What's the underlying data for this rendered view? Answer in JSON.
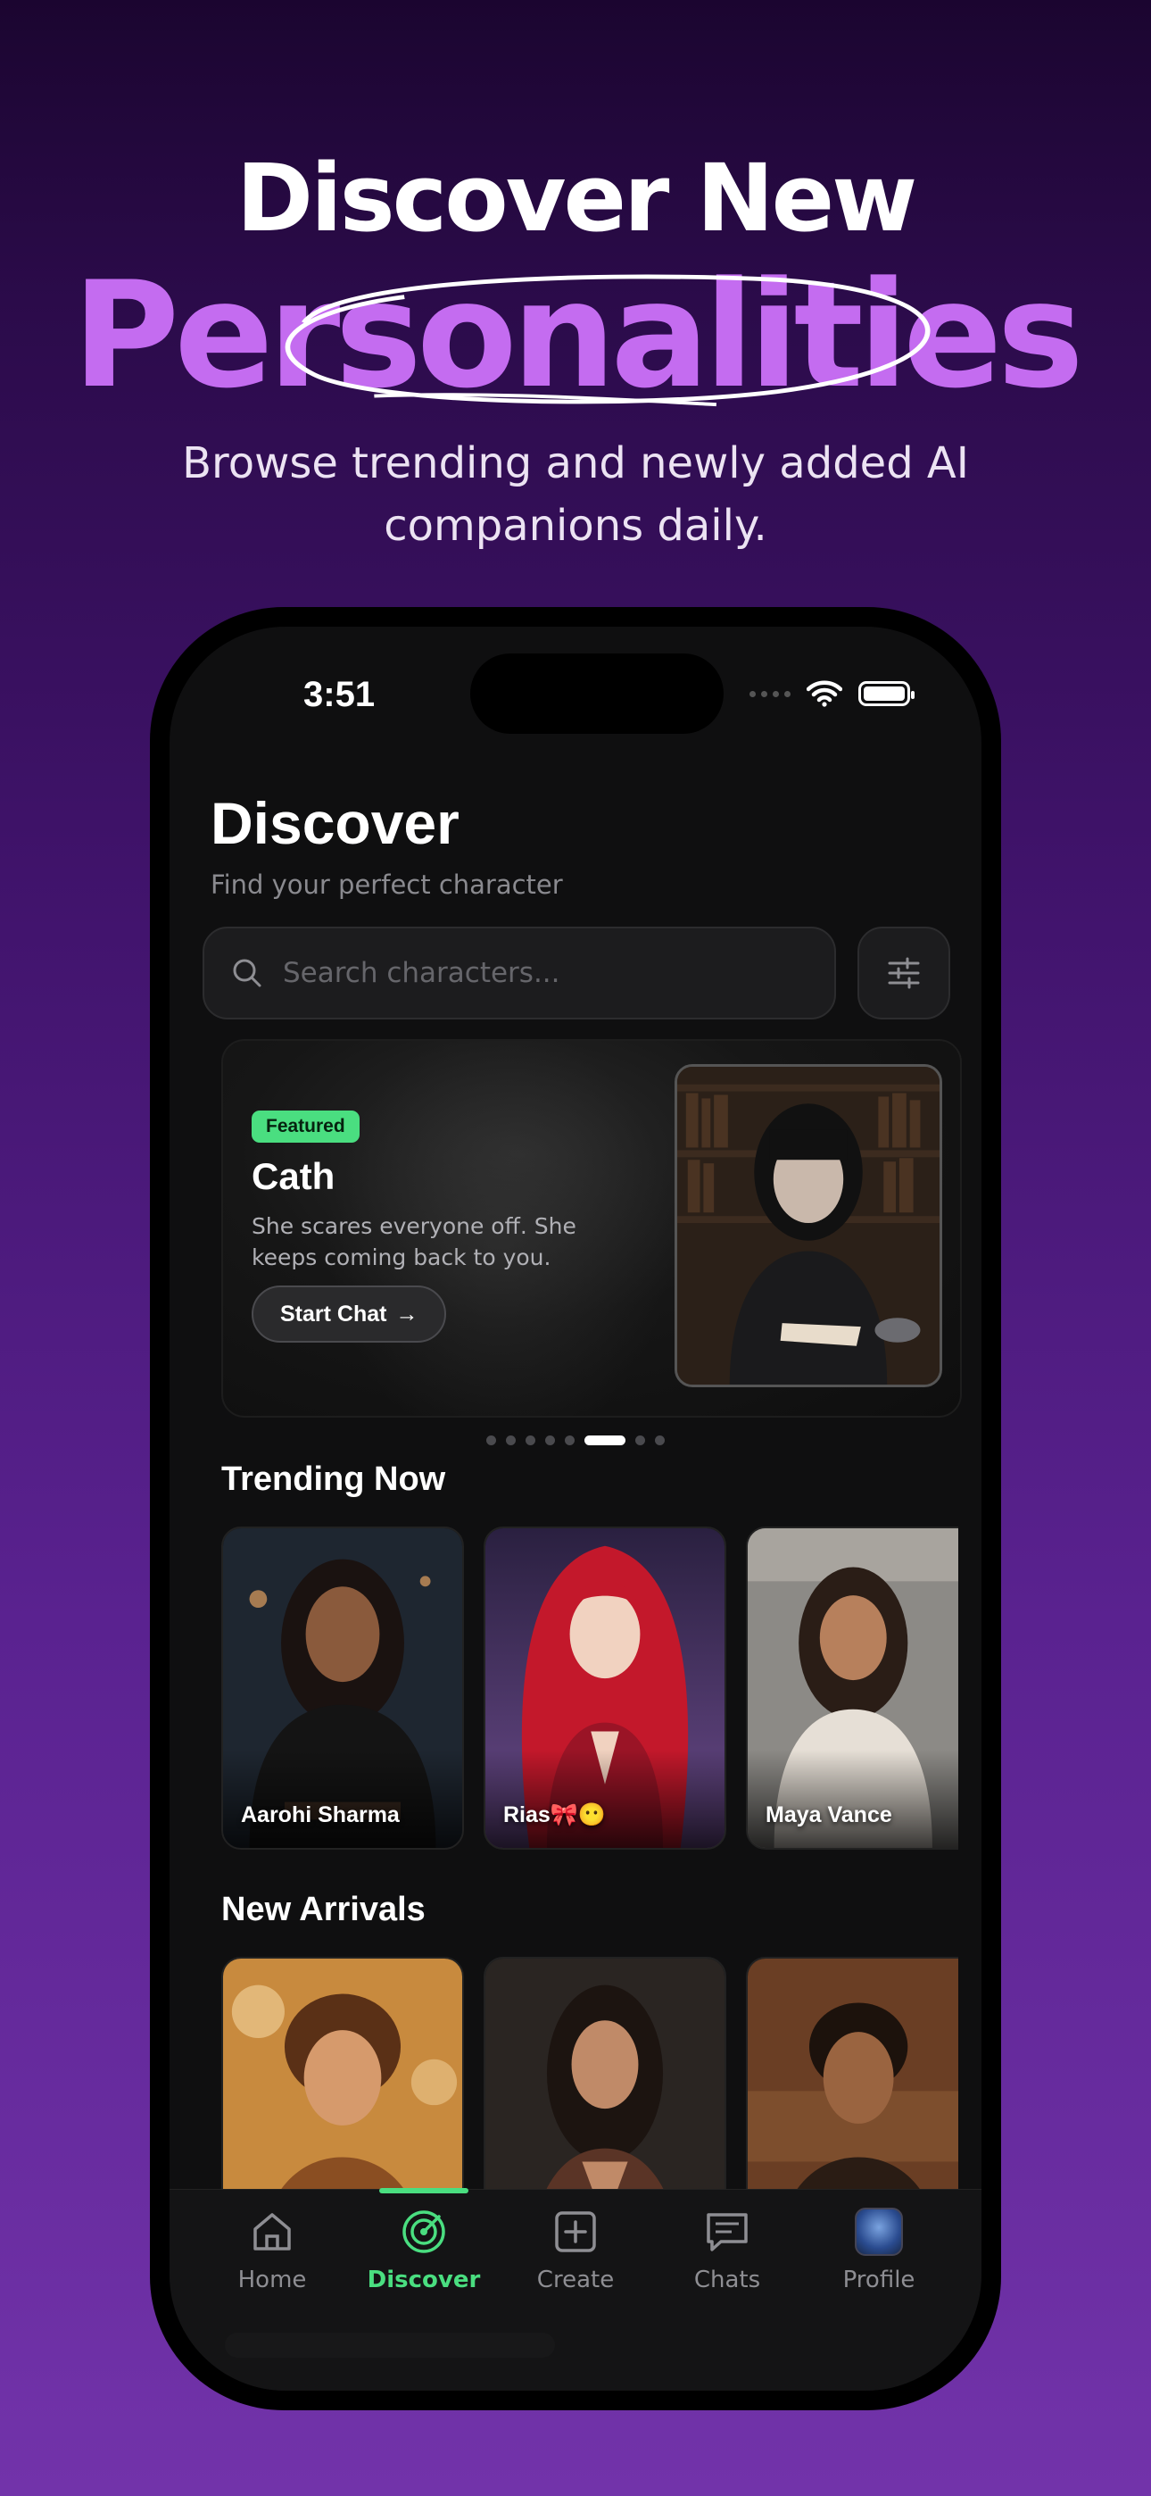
{
  "hero": {
    "line1": "Discover New",
    "line2": "Personalities",
    "subtitle_line1": "Browse trending and newly added AI",
    "subtitle_line2": "companions daily."
  },
  "status": {
    "time": "3:51"
  },
  "header": {
    "title": "Discover",
    "subtitle": "Find your perfect character"
  },
  "search": {
    "placeholder": "Search characters..."
  },
  "featured": {
    "badge": "Featured",
    "name": "Cath",
    "description": "She scares everyone off. She keeps coming back to you.",
    "button_label": "Start Chat",
    "button_arrow": "→"
  },
  "carousel": {
    "count": 8,
    "active_index": 5
  },
  "trending": {
    "title": "Trending Now",
    "items": [
      {
        "name": "Aarohi Sharma"
      },
      {
        "name": "Rias🎀😶"
      },
      {
        "name": "Maya Vance"
      }
    ]
  },
  "new_arrivals": {
    "title": "New Arrivals",
    "items": [
      {
        "name": ""
      },
      {
        "name": ""
      },
      {
        "name": ""
      }
    ]
  },
  "tabbar": {
    "items": [
      {
        "label": "Home",
        "icon": "home-icon"
      },
      {
        "label": "Discover",
        "icon": "radar-icon",
        "active": true
      },
      {
        "label": "Create",
        "icon": "plus-square-icon"
      },
      {
        "label": "Chats",
        "icon": "chat-icon"
      },
      {
        "label": "Profile",
        "icon": "avatar"
      }
    ]
  },
  "colors": {
    "accent_purple": "#c46cf0",
    "accent_green": "#4ade80",
    "screen_bg": "#0f0f10"
  }
}
